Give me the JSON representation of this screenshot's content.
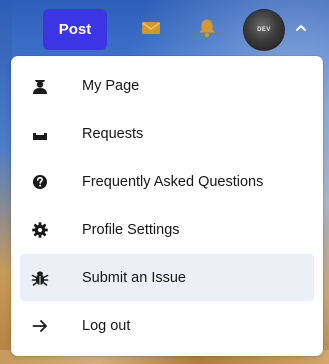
{
  "topbar": {
    "post_label": "Post",
    "avatar_text": "DEV",
    "accent": "#3b35e6",
    "icon_color": "#d39a2b"
  },
  "menu": {
    "items": [
      {
        "label": "My Page",
        "icon": "user-badge-icon"
      },
      {
        "label": "Requests",
        "icon": "requests-icon"
      },
      {
        "label": "Frequently Asked Questions",
        "icon": "question-icon"
      },
      {
        "label": "Profile Settings",
        "icon": "gear-icon"
      },
      {
        "label": "Submit an Issue",
        "icon": "bug-icon",
        "active": true
      },
      {
        "label": "Log out",
        "icon": "arrow-right-icon"
      }
    ]
  }
}
